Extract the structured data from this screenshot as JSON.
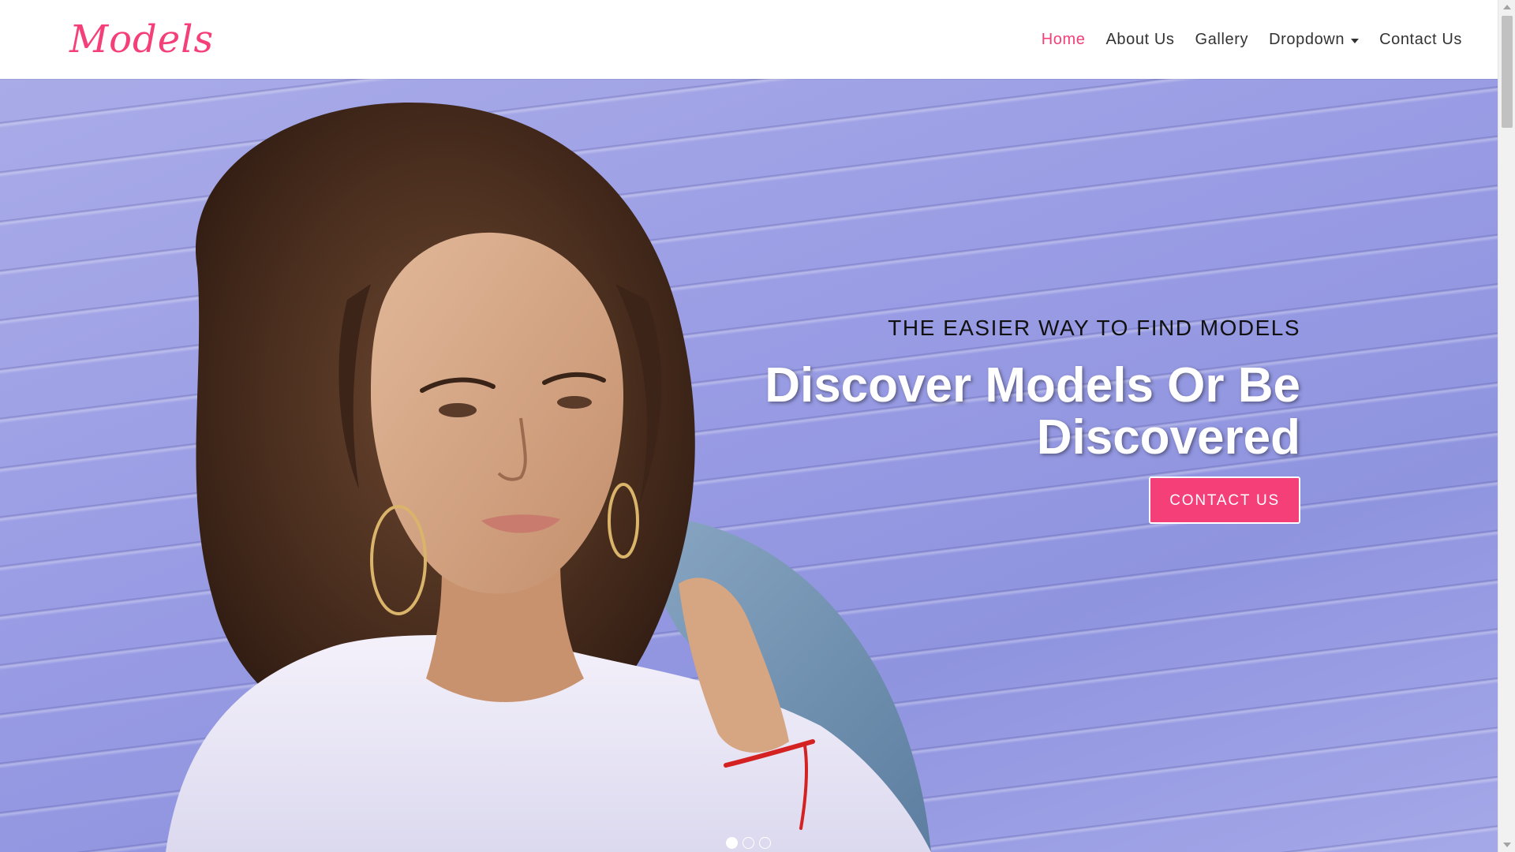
{
  "brand": {
    "logo_text": "Models",
    "accent_color": "#f43f79"
  },
  "nav": {
    "items": [
      {
        "label": "Home",
        "active": true
      },
      {
        "label": "About Us",
        "active": false
      },
      {
        "label": "Gallery",
        "active": false
      },
      {
        "label": "Dropdown",
        "active": false,
        "has_caret": true
      },
      {
        "label": "Contact Us",
        "active": false
      }
    ]
  },
  "hero": {
    "subtitle": "THE EASIER WAY TO FIND MODELS",
    "title_line1": "Discover Models Or Be",
    "title_line2": "Discovered",
    "button_label": "CONTACT US",
    "background_color": "#9da0e3",
    "slides_total": 3,
    "active_slide": 1
  },
  "icons": {
    "dropdown_caret": "caret-down-icon",
    "scroll_up": "chevron-up-icon",
    "scroll_down": "chevron-down-icon"
  }
}
